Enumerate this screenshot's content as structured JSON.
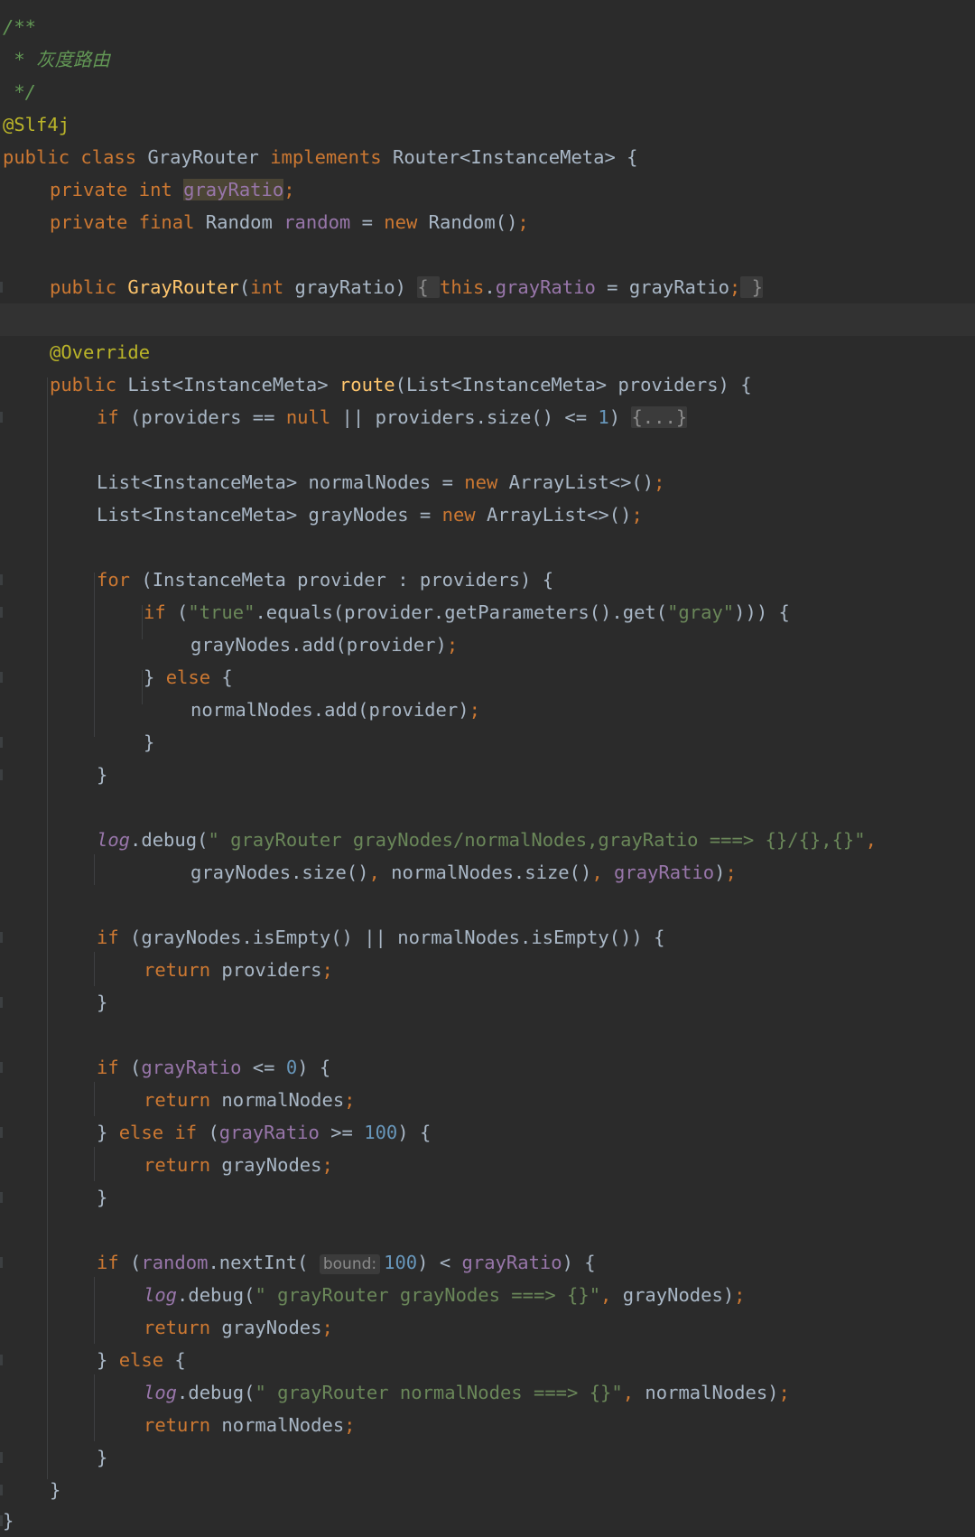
{
  "editor": {
    "file_lines": [
      "/**",
      " * 灰度路由",
      " */",
      "@Slf4j",
      "public class GrayRouter implements Router<InstanceMeta> {",
      "private int grayRatio;",
      "private final Random random = new Random();",
      "",
      "public GrayRouter(int grayRatio) { this.grayRatio = grayRatio; }",
      "",
      "@Override",
      "public List<InstanceMeta> route(List<InstanceMeta> providers) {",
      "if (providers == null || providers.size() <= 1) {...}",
      "",
      "List<InstanceMeta> normalNodes = new ArrayList<>();",
      "List<InstanceMeta> grayNodes = new ArrayList<>();",
      "",
      "for (InstanceMeta provider : providers) {",
      "if (\"true\".equals(provider.getParameters().get(\"gray\"))) {",
      "grayNodes.add(provider);",
      "} else {",
      "normalNodes.add(provider);",
      "}",
      "}",
      "",
      "log.debug(\" grayRouter grayNodes/normalNodes,grayRatio ===> {}/{},{}\",",
      "grayNodes.size(), normalNodes.size(), grayRatio);",
      "",
      "if (grayNodes.isEmpty() || normalNodes.isEmpty()) {",
      "return providers;",
      "}",
      "",
      "if (grayRatio <= 0) {",
      "return normalNodes;",
      "} else if (grayRatio >= 100) {",
      "return grayNodes;",
      "}",
      "",
      "if (random.nextInt( bound: 100) < grayRatio) {",
      "log.debug(\" grayRouter grayNodes ===> {}\", grayNodes);",
      "return grayNodes;",
      "} else {",
      "log.debug(\" grayRouter normalNodes ===> {}\", normalNodes);",
      "return normalNodes;",
      "}",
      "}",
      "}"
    ],
    "inlay_hint": "bound:",
    "folded_block": "{...}",
    "highlighted_symbol": "grayRatio",
    "colors": {
      "background": "#2b2b2b",
      "caret_row": "#323232",
      "default_text": "#a9b7c6",
      "keyword": "#cc7832",
      "comment": "#629755",
      "annotation": "#bbb529",
      "field": "#9876aa",
      "method_declaration": "#ffc66d",
      "string": "#6a8759",
      "number": "#6897bb"
    }
  }
}
